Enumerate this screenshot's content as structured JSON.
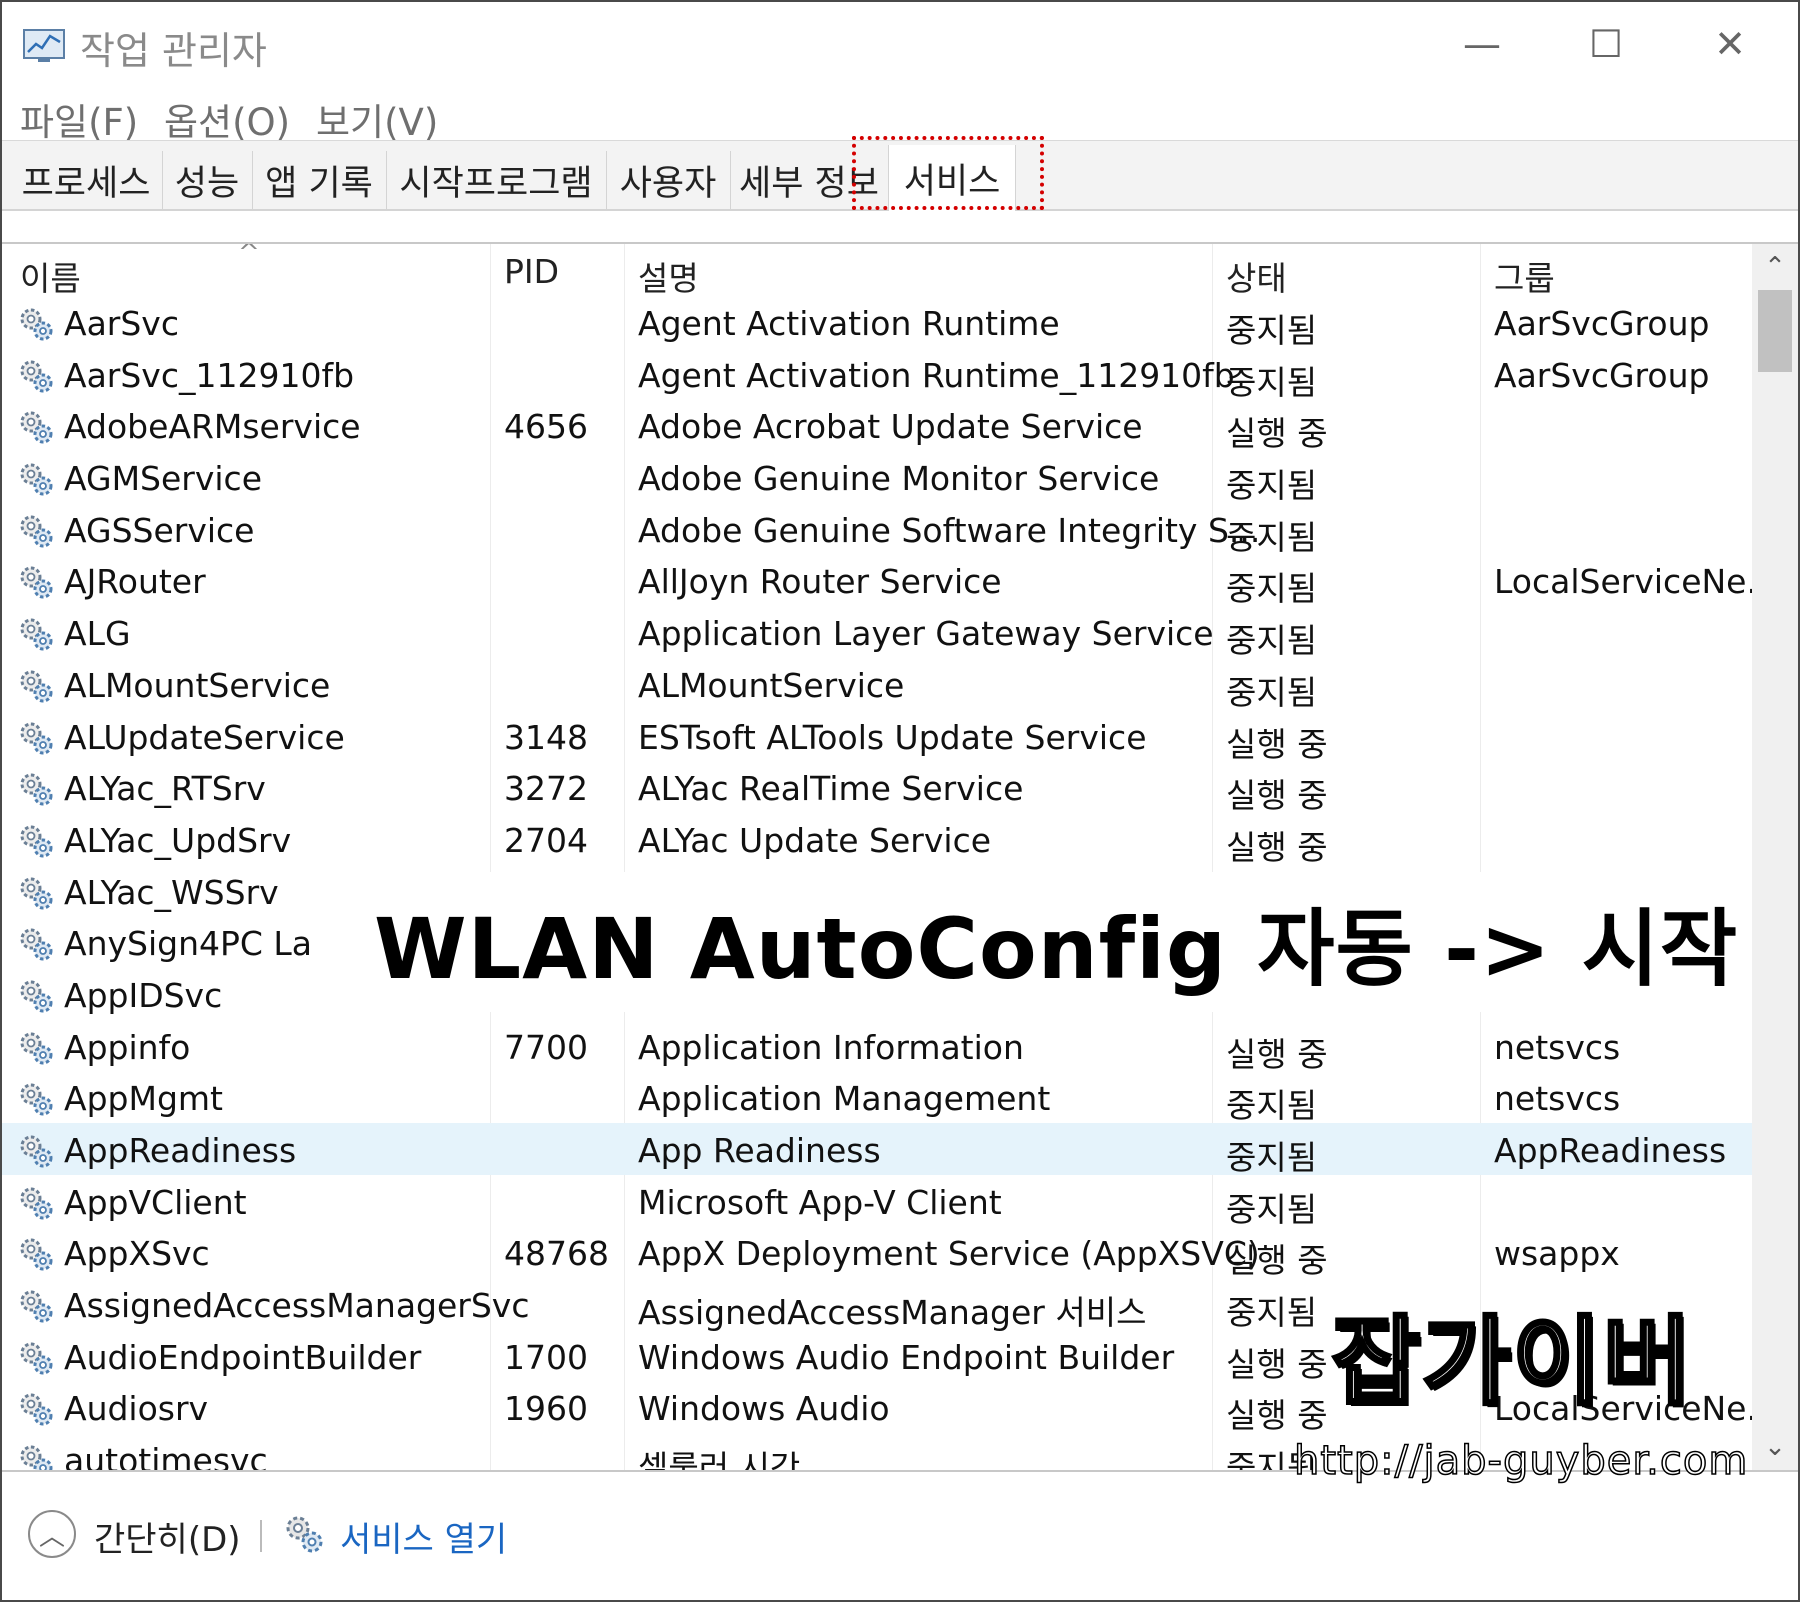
{
  "window": {
    "title": "작업 관리자",
    "minimize": "—",
    "maximize": "☐",
    "close": "✕"
  },
  "menu": [
    {
      "label": "파일(F)"
    },
    {
      "label": "옵션(O)"
    },
    {
      "label": "보기(V)"
    }
  ],
  "tabs": [
    {
      "label": "프로세스"
    },
    {
      "label": "성능"
    },
    {
      "label": "앱 기록"
    },
    {
      "label": "시작프로그램"
    },
    {
      "label": "사용자"
    },
    {
      "label": "세부 정보"
    },
    {
      "label": "서비스",
      "active": true
    }
  ],
  "columns": {
    "name": "이름",
    "pid": "PID",
    "desc": "설명",
    "status": "상태",
    "group": "그룹"
  },
  "rows": [
    {
      "name": "AarSvc",
      "pid": "",
      "desc": "Agent Activation Runtime",
      "status": "중지됨",
      "group": "AarSvcGroup"
    },
    {
      "name": "AarSvc_112910fb",
      "pid": "",
      "desc": "Agent Activation Runtime_112910fb",
      "status": "중지됨",
      "group": "AarSvcGroup"
    },
    {
      "name": "AdobeARMservice",
      "pid": "4656",
      "desc": "Adobe Acrobat Update Service",
      "status": "실행 중",
      "group": ""
    },
    {
      "name": "AGMService",
      "pid": "",
      "desc": "Adobe Genuine Monitor Service",
      "status": "중지됨",
      "group": ""
    },
    {
      "name": "AGSService",
      "pid": "",
      "desc": "Adobe Genuine Software Integrity S...",
      "status": "중지됨",
      "group": ""
    },
    {
      "name": "AJRouter",
      "pid": "",
      "desc": "AllJoyn Router Service",
      "status": "중지됨",
      "group": "LocalServiceNe..."
    },
    {
      "name": "ALG",
      "pid": "",
      "desc": "Application Layer Gateway Service",
      "status": "중지됨",
      "group": ""
    },
    {
      "name": "ALMountService",
      "pid": "",
      "desc": "ALMountService",
      "status": "중지됨",
      "group": ""
    },
    {
      "name": "ALUpdateService",
      "pid": "3148",
      "desc": "ESTsoft ALTools Update Service",
      "status": "실행 중",
      "group": ""
    },
    {
      "name": "ALYac_RTSrv",
      "pid": "3272",
      "desc": "ALYac RealTime Service",
      "status": "실행 중",
      "group": ""
    },
    {
      "name": "ALYac_UpdSrv",
      "pid": "2704",
      "desc": "ALYac Update Service",
      "status": "실행 중",
      "group": ""
    },
    {
      "name": "ALYac_WSSrv",
      "pid": "",
      "desc": "",
      "status": "",
      "group": ""
    },
    {
      "name": "AnySign4PC La",
      "pid": "",
      "desc": "",
      "status": "",
      "group": ""
    },
    {
      "name": "AppIDSvc",
      "pid": "",
      "desc": "",
      "status": "",
      "group": ""
    },
    {
      "name": "Appinfo",
      "pid": "7700",
      "desc": "Application Information",
      "status": "실행 중",
      "group": "netsvcs"
    },
    {
      "name": "AppMgmt",
      "pid": "",
      "desc": "Application Management",
      "status": "중지됨",
      "group": "netsvcs"
    },
    {
      "name": "AppReadiness",
      "pid": "",
      "desc": "App Readiness",
      "status": "중지됨",
      "group": "AppReadiness",
      "selected": true
    },
    {
      "name": "AppVClient",
      "pid": "",
      "desc": "Microsoft App-V Client",
      "status": "중지됨",
      "group": ""
    },
    {
      "name": "AppXSvc",
      "pid": "48768",
      "desc": "AppX Deployment Service (AppXSVC)",
      "status": "실행 중",
      "group": "wsappx"
    },
    {
      "name": "AssignedAccessManagerSvc",
      "pid": "",
      "desc": "AssignedAccessManager 서비스",
      "status": "중지됨",
      "group": ""
    },
    {
      "name": "AudioEndpointBuilder",
      "pid": "1700",
      "desc": "Windows Audio Endpoint Builder",
      "status": "실행 중",
      "group": ""
    },
    {
      "name": "Audiosrv",
      "pid": "1960",
      "desc": "Windows Audio",
      "status": "실행 중",
      "group": "LocalServiceNe..."
    },
    {
      "name": "autotimesvc",
      "pid": "",
      "desc": "셀룰러 시간",
      "status": "중지됨",
      "group": ""
    }
  ],
  "footer": {
    "fewer_details": "간단히(D)",
    "open_services": "서비스 열기"
  },
  "overlay": {
    "caption": "WLAN AutoConfig 자동 -> 시작",
    "watermark": "잡가이버",
    "watermark_url": "http://jab-guyber.com"
  },
  "icons": {
    "app": "task-manager-icon",
    "service": "gear-icon",
    "collapse": "chevron-up-icon"
  },
  "colors": {
    "selected_row": "#e5f3fb",
    "link": "#1a66c2",
    "highlight_box": "#d40000"
  }
}
